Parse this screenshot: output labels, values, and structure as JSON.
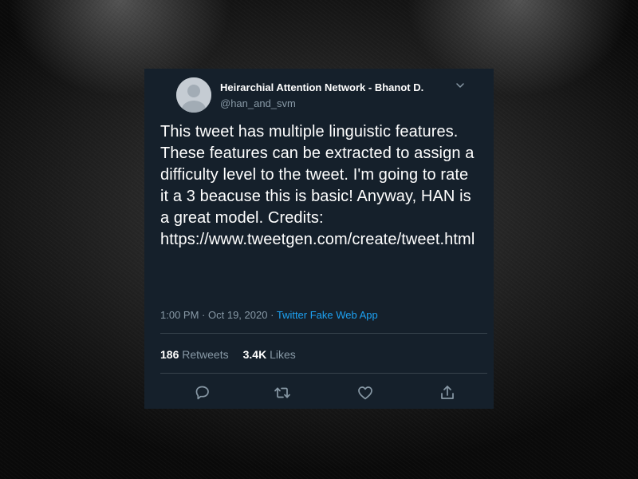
{
  "tweet": {
    "display_name": "Heirarchial Attention Network - Bhanot D.",
    "handle": "@han_and_svm",
    "text": "This tweet has multiple linguistic features. These features can be extracted to assign a difficulty level to the tweet. I'm going to rate it a 3 beacuse this is basic! Anyway, HAN is a great model. Credits: https://www.tweetgen.com/create/tweet.html",
    "time": "1:00 PM",
    "separator": "·",
    "date": "Oct 19, 2020",
    "source": "Twitter Fake Web App",
    "retweets_count": "186",
    "retweets_label": "Retweets",
    "likes_count": "3.4K",
    "likes_label": "Likes"
  },
  "icons": {
    "menu": "chevron-down-icon",
    "reply": "reply-icon",
    "retweet": "retweet-icon",
    "like": "heart-icon",
    "share": "share-icon"
  },
  "colors": {
    "card_bg": "#15202b",
    "secondary_text": "#8899a6",
    "link": "#1da1f2",
    "divider": "#38444d"
  }
}
